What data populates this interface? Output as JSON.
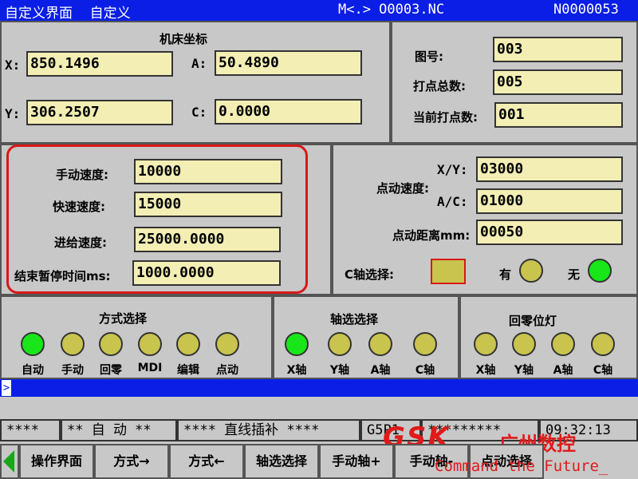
{
  "title": {
    "left": "自定义界面    自定义",
    "program": "M<.> O0003.NC",
    "seq": "N0000053"
  },
  "machine_coords": {
    "heading": "机床坐标",
    "x_label": "X:",
    "x_value": "850.1496",
    "y_label": "Y:",
    "y_value": "306.2507",
    "a_label": "A:",
    "a_value": "50.4890",
    "c_label": "C:",
    "c_value": "0.0000"
  },
  "drawing": {
    "fig_label": "图号:",
    "fig_value": "003",
    "total_label": "打点总数:",
    "total_value": "005",
    "current_label": "当前打点数:",
    "current_value": "001"
  },
  "speeds": {
    "manual_label": "手动速度:",
    "manual_value": "10000",
    "rapid_label": "快速速度:",
    "rapid_value": "15000",
    "feed_label": "进给速度:",
    "feed_value": "25000.0000",
    "pause_label": "结束暂停时间ms:",
    "pause_value": "1000.0000"
  },
  "jog": {
    "speed_label": "点动速度:",
    "xy_label": "X/Y:",
    "xy_value": "03000",
    "ac_label": "A/C:",
    "ac_value": "01000",
    "dist_label": "点动距离mm:",
    "dist_value": "00050",
    "c_axis_label": "C轴选择:",
    "have_label": "有",
    "none_label": "无"
  },
  "mode_group": {
    "title": "方式选择",
    "lamps": [
      {
        "label": "自动",
        "on": true
      },
      {
        "label": "手动",
        "on": false
      },
      {
        "label": "回零",
        "on": false
      },
      {
        "label": "MDI",
        "on": false
      },
      {
        "label": "编辑",
        "on": false
      },
      {
        "label": "点动",
        "on": false
      }
    ]
  },
  "axis_group": {
    "title": "轴选选择",
    "lamps": [
      {
        "label": "X轴",
        "on": true
      },
      {
        "label": "Y轴",
        "on": false
      },
      {
        "label": "A轴",
        "on": false
      },
      {
        "label": "C轴",
        "on": false
      }
    ]
  },
  "home_group": {
    "title": "回零位灯",
    "lamps": [
      {
        "label": "X轴",
        "on": false
      },
      {
        "label": "Y轴",
        "on": false
      },
      {
        "label": "A轴",
        "on": false
      },
      {
        "label": "C轴",
        "on": false
      }
    ]
  },
  "status": {
    "s1": "****",
    "s2": "** 自 动 **",
    "s3": "**** 直线插补 ****",
    "s4": "G5P1",
    "s5": "*********",
    "time": "09:32:13"
  },
  "softkeys": [
    "操作界面",
    "方式→",
    "方式←",
    "轴选选择",
    "手动轴+",
    "手动轴-",
    "点动选择"
  ],
  "brand": {
    "logo": "GSK",
    "company": "广州数控",
    "slogan": "Command the Future_"
  },
  "colors": {
    "title_bg": "#0a1ee6",
    "field_bg": "#f3eeb4",
    "lamp_on": "#19e619",
    "lamp_off": "#c8c44e",
    "highlight": "#d81818"
  }
}
